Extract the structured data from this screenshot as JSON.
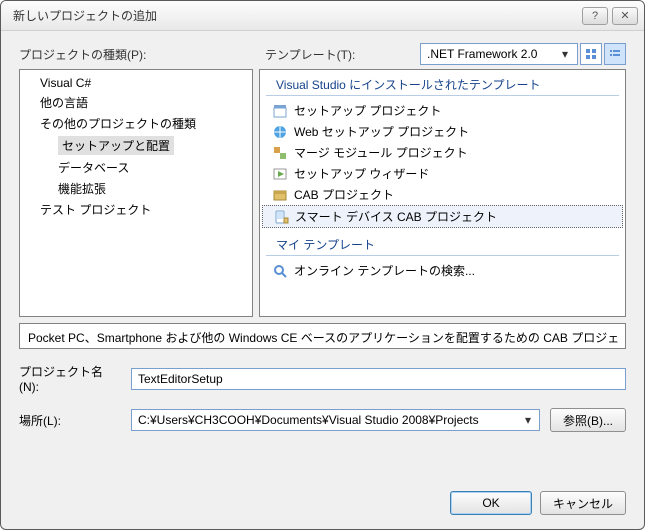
{
  "window": {
    "title": "新しいプロジェクトの追加"
  },
  "labels": {
    "project_types": "プロジェクトの種類(P):",
    "templates": "テンプレート(T):",
    "project_name": "プロジェクト名(N):",
    "location": "場所(L):",
    "browse": "参照(B)...",
    "ok": "OK",
    "cancel": "キャンセル"
  },
  "framework": {
    "selected": ".NET Framework 2.0"
  },
  "tree": {
    "items": [
      "Visual C#",
      "他の言語",
      "その他のプロジェクトの種類"
    ],
    "sub_items": [
      "セットアップと配置",
      "データベース",
      "機能拡張"
    ],
    "last_item": "テスト プロジェクト"
  },
  "template_sections": {
    "installed": "Visual Studio にインストールされたテンプレート",
    "my": "マイ テンプレート"
  },
  "templates": {
    "installed": [
      "セットアップ プロジェクト",
      "Web セットアップ プロジェクト",
      "マージ モジュール プロジェクト",
      "セットアップ ウィザード",
      "CAB プロジェクト",
      "スマート デバイス CAB プロジェクト"
    ],
    "my": [
      "オンライン テンプレートの検索..."
    ]
  },
  "description": "Pocket PC、Smartphone および他の Windows CE ベースのアプリケーションを配置するための CAB プロジェ",
  "form": {
    "name_value": "TextEditorSetup",
    "location_value": "C:¥Users¥CH3COOH¥Documents¥Visual Studio 2008¥Projects"
  }
}
